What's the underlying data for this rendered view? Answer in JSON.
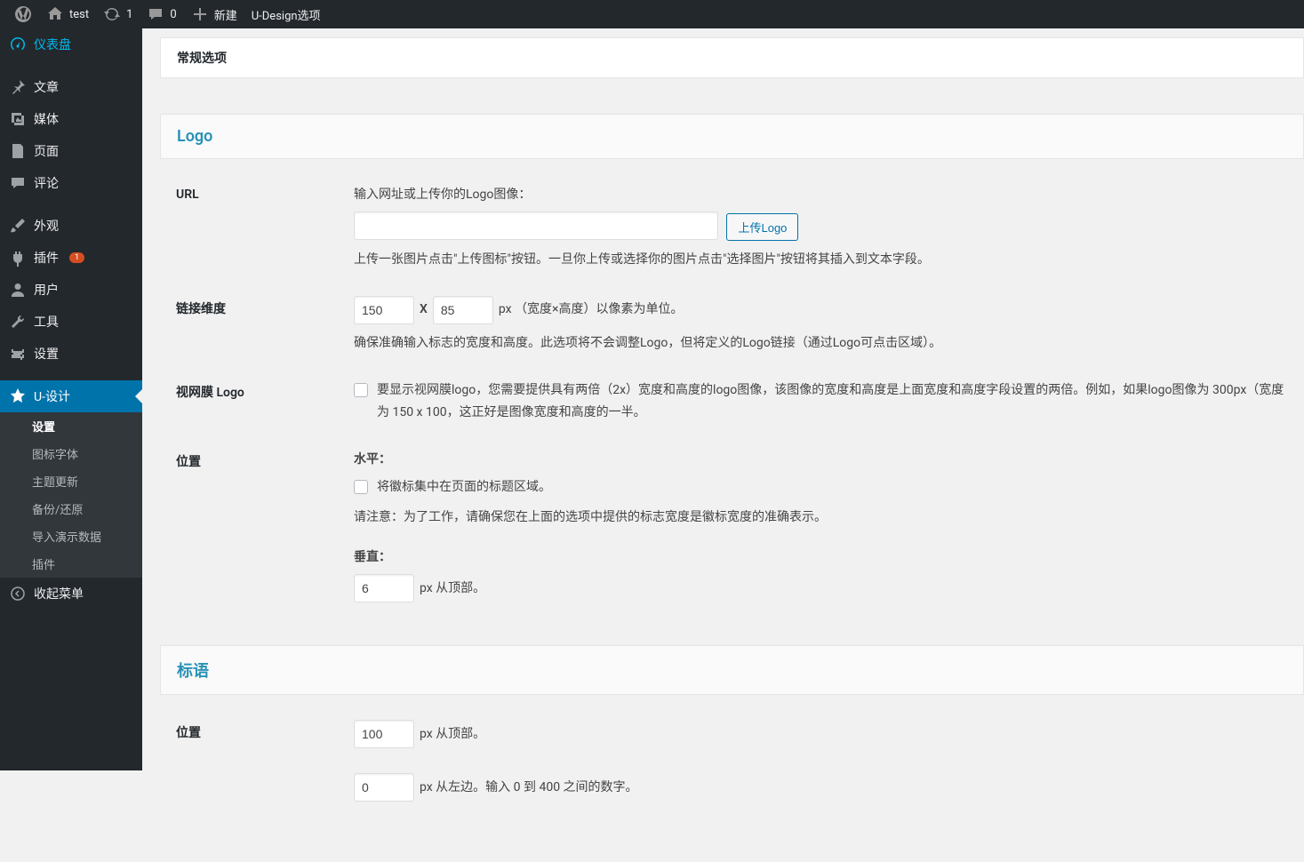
{
  "adminbar": {
    "site_name": "test",
    "updates": "1",
    "comments": "0",
    "new_label": "新建",
    "udesign_label": "U-Design选项"
  },
  "sidebar": {
    "dashboard": "仪表盘",
    "posts": "文章",
    "media": "媒体",
    "pages": "页面",
    "comments": "评论",
    "appearance": "外观",
    "plugins": "插件",
    "plugins_badge": "1",
    "users": "用户",
    "tools": "工具",
    "settings": "设置",
    "udesign": "U-设计",
    "submenu": {
      "settings": "设置",
      "icon_fonts": "图标字体",
      "theme_update": "主题更新",
      "backup": "备份/还原",
      "import_demo": "导入演示数据",
      "plugins": "插件"
    },
    "collapse": "收起菜单"
  },
  "panel": {
    "header": "常规选项",
    "logo": {
      "title": "Logo",
      "url_label": "URL",
      "url_hint": "输入网址或上传你的Logo图像：",
      "url_value": "",
      "upload_btn": "上传Logo",
      "url_desc": "上传一张图片点击\"上传图标\"按钮。一旦你上传或选择你的图片点击\"选择图片\"按钮将其插入到文本字段。",
      "dim_label": "链接维度",
      "dim_width": "150",
      "dim_times": "X",
      "dim_height": "85",
      "dim_unit": "px （宽度×高度）以像素为单位。",
      "dim_desc": "确保准确输入标志的宽度和高度。此选项将不会调整Logo，但将定义的Logo链接（通过Logo可点击区域）。",
      "retina_label": "视网膜 Logo",
      "retina_desc": "要显示视网膜logo，您需要提供具有两倍（2x）宽度和高度的logo图像，该图像的宽度和高度是上面宽度和高度字段设置的两倍。例如，如果logo图像为 300px（宽度为 150 x 100，这正好是图像宽度和高度的一半。",
      "pos_label": "位置",
      "pos_h_label": "水平：",
      "pos_h_center": "将徽标集中在页面的标题区域。",
      "pos_h_note": "请注意：为了工作，请确保您在上面的选项中提供的标志宽度是徽标宽度的准确表示。",
      "pos_v_label": "垂直：",
      "pos_v_value": "6",
      "pos_v_unit": "px 从顶部。"
    },
    "slogan": {
      "title": "标语",
      "pos_label": "位置",
      "top_value": "100",
      "top_unit": "px 从顶部。",
      "left_value": "0",
      "left_unit": "px 从左边。输入 0 到 400 之间的数字。"
    }
  }
}
